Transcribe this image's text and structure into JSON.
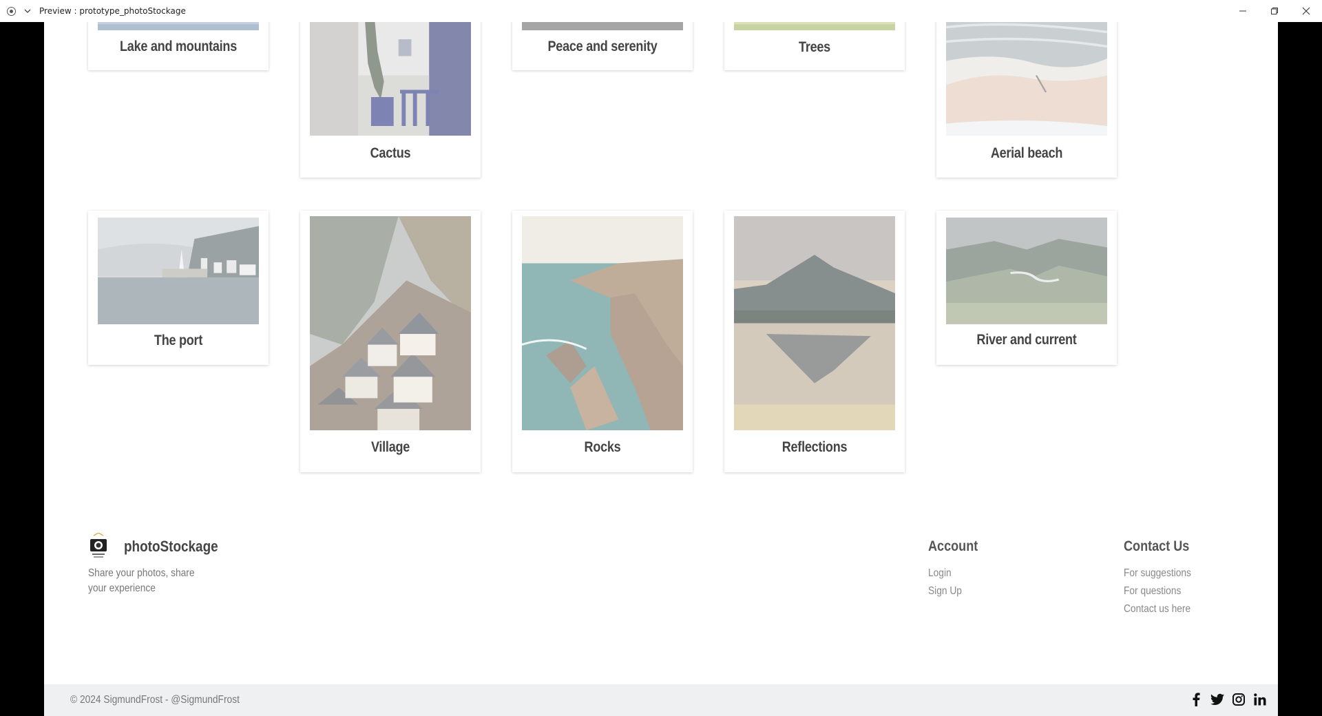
{
  "window": {
    "title": "Preview : prototype_photoStockage"
  },
  "gallery": {
    "top_row": [
      {
        "label": "Lake and mountains"
      },
      {
        "label": "Cactus"
      },
      {
        "label": "Peace and serenity"
      },
      {
        "label": "Trees"
      },
      {
        "label": "Aerial beach"
      }
    ],
    "bottom_row": [
      {
        "label": "The port"
      },
      {
        "label": "Village"
      },
      {
        "label": "Rocks"
      },
      {
        "label": "Reflections"
      },
      {
        "label": "River and current"
      }
    ]
  },
  "footer": {
    "brand_name": "photoStockage",
    "tagline": "Share your photos, share your experience",
    "account": {
      "heading": "Account",
      "links": [
        "Login",
        "Sign Up"
      ]
    },
    "contact": {
      "heading": "Contact Us",
      "links": [
        "For suggestions",
        "For questions",
        "Contact us here"
      ]
    },
    "copyright": "© 2024 SigmundFrost - @SigmundFrost",
    "socials": [
      "facebook-icon",
      "twitter-icon",
      "instagram-icon",
      "linkedin-icon"
    ]
  }
}
